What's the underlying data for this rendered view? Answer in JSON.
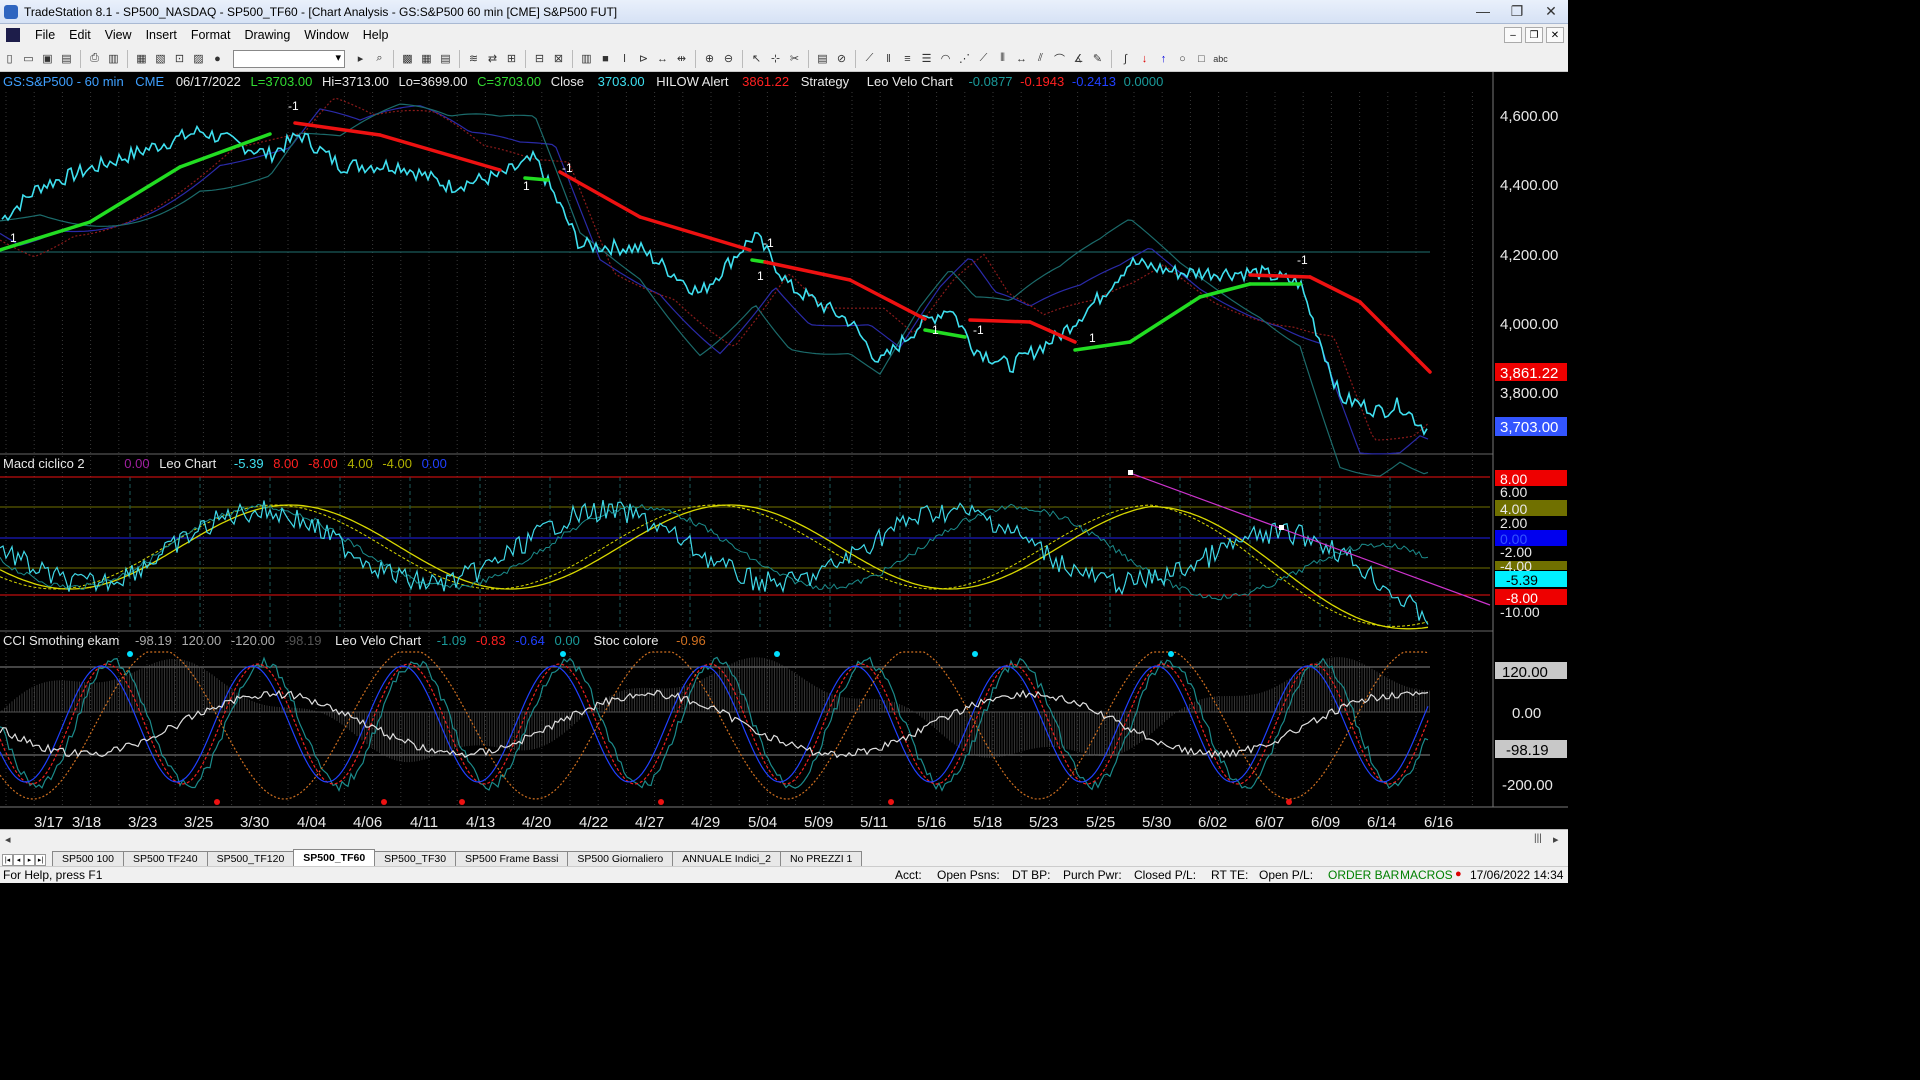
{
  "window": {
    "title": "TradeStation 8.1 - SP500_NASDAQ - SP500_TF60 - [Chart Analysis - GS:S&P500  60 min  [CME] S&P500 FUT]",
    "minimize": "—",
    "maximize": "❐",
    "close": "✕"
  },
  "menu": [
    "File",
    "Edit",
    "View",
    "Insert",
    "Format",
    "Drawing",
    "Window",
    "Help"
  ],
  "toolbar": {
    "symbol_combo_value": ""
  },
  "price_pane": {
    "header": {
      "symbol": "GS:S&P500 - 60 min",
      "exchange": "CME",
      "date": "06/17/2022",
      "last": "L=3703.00",
      "high": "Hi=3713.00",
      "low": "Lo=3699.00",
      "close_eq": "C=3703.00",
      "close_label": "Close",
      "close_value": "3703.00",
      "alert_label": "HILOW Alert",
      "alert_value": "3861.22",
      "strategy_label": "Strategy",
      "velo_label": "Leo Velo Chart",
      "v1": "-0.0877",
      "v2": "-0.1943",
      "v3": "-0.2413",
      "v4": "0.0000"
    },
    "axis": [
      "4,600.00",
      "4,400.00",
      "4,200.00",
      "4,000.00",
      "3,800.00"
    ],
    "axis_values": [
      4600,
      4400,
      4200,
      4000,
      3800
    ],
    "badge_alert": "3,861.22",
    "badge_close": "3,703.00",
    "markers": [
      "1",
      "-1",
      "1",
      "-1",
      "1",
      "-1",
      "1",
      "-1",
      "1",
      "-1",
      "1",
      "-1"
    ]
  },
  "macd_pane": {
    "header": {
      "name": "Macd ciclico 2",
      "v0": "0.00",
      "leo": "Leo Chart",
      "a": "-5.39",
      "b": "8.00",
      "c": "-8.00",
      "d": "4.00",
      "e": "-4.00",
      "f": "0.00"
    },
    "axis": [
      "8.00",
      "6.00",
      "4.00",
      "2.00",
      "0.00",
      "-2.00",
      "-4.00",
      "-5.39",
      "-8.00",
      "-10.00"
    ]
  },
  "cci_pane": {
    "header": {
      "name": "CCI Smothing ekam",
      "a": "-98.19",
      "b": "120.00",
      "c": "-120.00",
      "d": "-98.19",
      "velo": "Leo Velo Chart",
      "v1": "-1.09",
      "v2": "-0.83",
      "v3": "-0.64",
      "v4": "0.00",
      "stoc": "Stoc colore",
      "stoc_v": "-0.96"
    },
    "axis": [
      "120.00",
      "0.00",
      "-98.19",
      "-200.00"
    ]
  },
  "x_axis": [
    "3/17",
    "3/18",
    "3/23",
    "3/25",
    "3/30",
    "4/04",
    "4/06",
    "4/11",
    "4/13",
    "4/20",
    "4/22",
    "4/27",
    "4/29",
    "5/04",
    "5/09",
    "5/11",
    "5/16",
    "5/18",
    "5/23",
    "5/25",
    "5/30",
    "6/02",
    "6/07",
    "6/09",
    "6/14",
    "6/16"
  ],
  "tabs": [
    "SP500 100",
    "SP500 TF240",
    "SP500_TF120",
    "SP500_TF60",
    "SP500_TF30",
    "SP500 Frame Bassi",
    "SP500 Giornaliero",
    "ANNUALE Indici_2",
    "No PREZZI 1"
  ],
  "active_tab": "SP500_TF60",
  "status": {
    "help": "For Help, press F1",
    "acct": "Acct:",
    "open_psns": "Open Psns:",
    "dt_bp": "DT BP:",
    "purch_pwr": "Purch Pwr:",
    "closed_pl": "Closed P/L:",
    "rt_te": "RT TE:",
    "open_pl": "Open P/L:",
    "order_bar": "ORDER BAR",
    "macros": "MACROS",
    "datetime": "17/06/2022 14:34"
  },
  "colors": {
    "price": "#3fe0f0",
    "hilow_up": "#22dd22",
    "hilow_down": "#ee1111",
    "axis_badge_red": "#ee0000",
    "axis_badge_blue": "#3355ff",
    "macd_yellow": "#d8d800",
    "trend_line": "#cc33cc"
  }
}
